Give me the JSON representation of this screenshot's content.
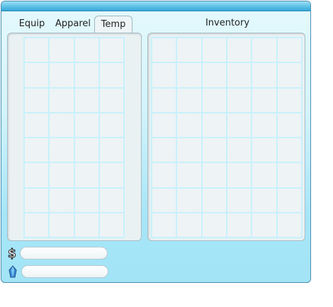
{
  "tabs": [
    {
      "label": "Equip",
      "active": false
    },
    {
      "label": "Apparel",
      "active": false
    },
    {
      "label": "Temp",
      "active": true
    }
  ],
  "inventory": {
    "title": "Inventory"
  },
  "left_grid": {
    "columns": 4,
    "rows": 8
  },
  "right_grid": {
    "columns": 6,
    "rows": 8
  },
  "currency": {
    "money_icon": "dollar-icon",
    "money_value": "",
    "crystal_icon": "crystal-icon",
    "crystal_value": ""
  },
  "colors": {
    "titlebar": "#58bfe6",
    "panel_bg": "#e9f1f3",
    "grid_line": "#c8f1fb"
  }
}
